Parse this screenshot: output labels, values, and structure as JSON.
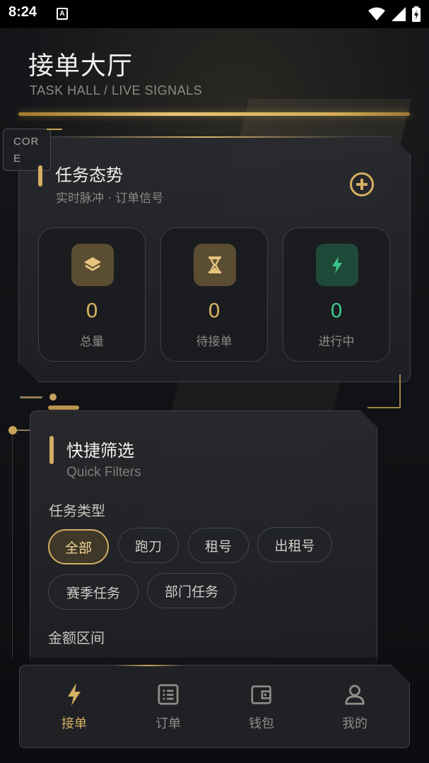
{
  "status_bar": {
    "time": "8:24",
    "notification_letter": "A"
  },
  "header": {
    "title": "接单大厅",
    "subtitle": "TASK HALL / LIVE SIGNALS"
  },
  "core_tag": {
    "line1": "COR",
    "line2": "E"
  },
  "task_card": {
    "title": "任务态势",
    "subtitle": "实时脉冲 · 订单信号",
    "stats": [
      {
        "value": "0",
        "label": "总量",
        "icon": "layers-icon",
        "color": "#d6b062"
      },
      {
        "value": "0",
        "label": "待接单",
        "icon": "hourglass-icon",
        "color": "#d6b062"
      },
      {
        "value": "0",
        "label": "进行中",
        "icon": "bolt-icon",
        "color": "#3fc48a"
      }
    ]
  },
  "filters": {
    "title": "快捷筛选",
    "subtitle": "Quick Filters",
    "type_label": "任务类型",
    "type_chips": [
      "全部",
      "跑刀",
      "租号",
      "出租号",
      "赛季任务",
      "部门任务"
    ],
    "active_type": "全部",
    "amount_label": "金额区间"
  },
  "bottom_nav": [
    {
      "label": "接单",
      "icon": "bolt-icon",
      "active": true
    },
    {
      "label": "订单",
      "icon": "list-icon",
      "active": false
    },
    {
      "label": "钱包",
      "icon": "wallet-icon",
      "active": false
    },
    {
      "label": "我的",
      "icon": "user-icon",
      "active": false
    }
  ],
  "colors": {
    "accent_gold": "#d6b062",
    "accent_green": "#3fc48a",
    "background": "#0b0d10"
  }
}
